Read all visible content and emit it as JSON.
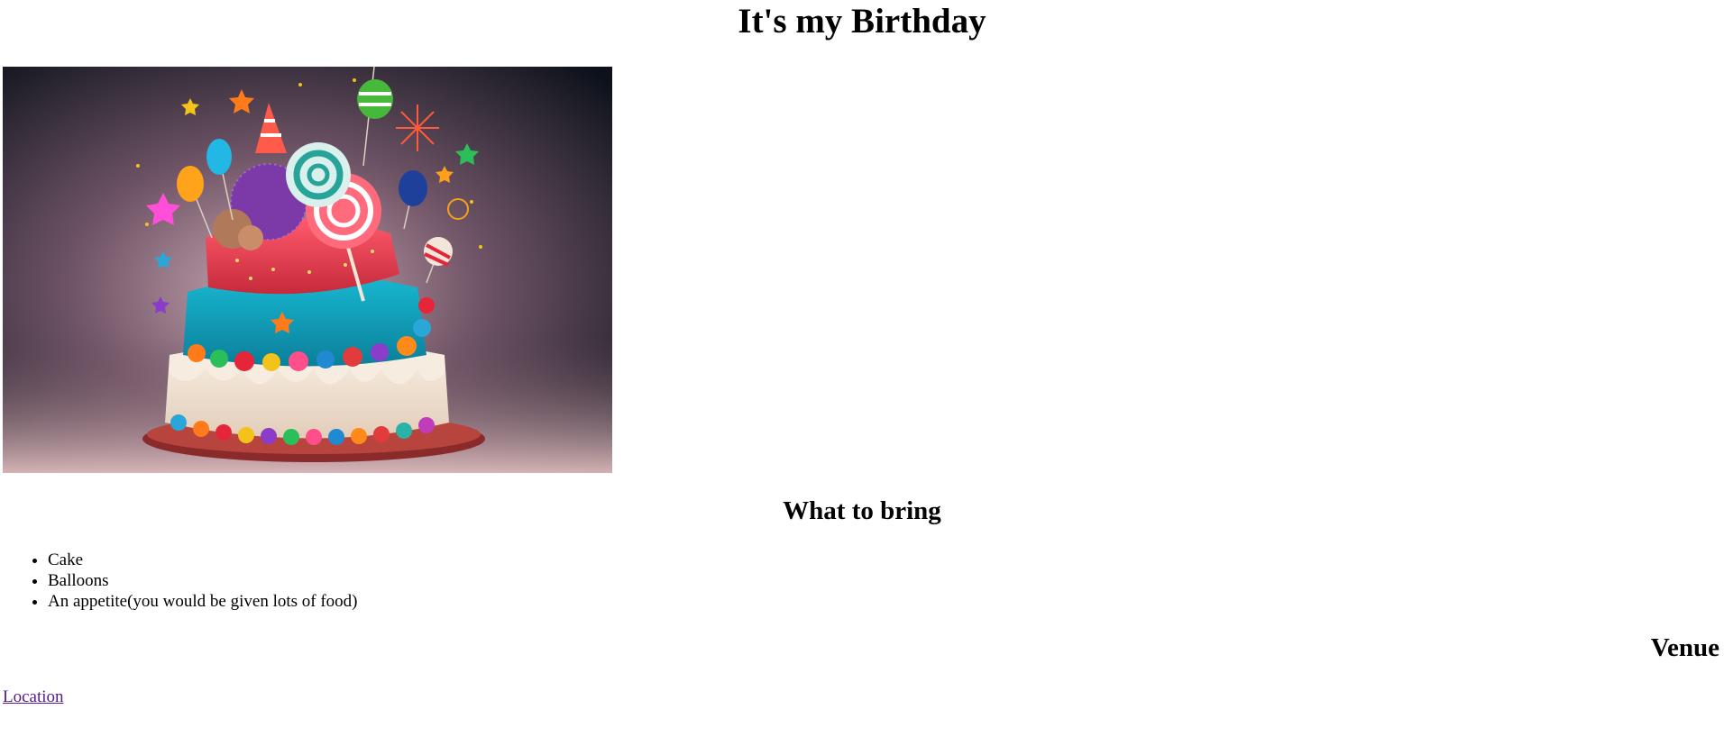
{
  "page": {
    "title": "It's my Birthday"
  },
  "hero_image": {
    "subject": "birthday-cake-illustration"
  },
  "bring_section": {
    "heading": "What to bring",
    "items": [
      "Cake",
      "Balloons",
      "An appetite(you would be given lots of food)"
    ]
  },
  "venue_section": {
    "heading": "Venue",
    "link_label": "Location"
  },
  "colors": {
    "link_visited": "#551a8b",
    "text": "#000000",
    "background": "#ffffff"
  }
}
